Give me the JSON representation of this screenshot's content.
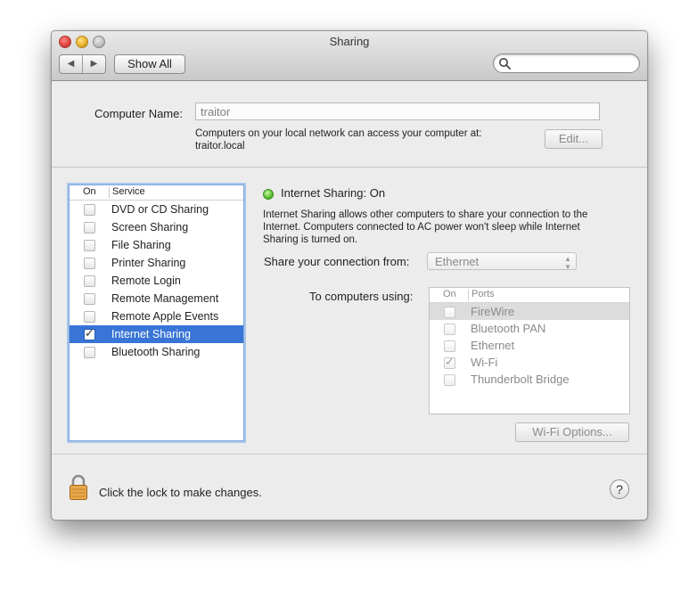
{
  "window": {
    "title": "Sharing",
    "nav_back_glyph": "◀",
    "nav_forward_glyph": "▶",
    "show_all_label": "Show All",
    "search": {
      "value": "",
      "placeholder": "",
      "icon": "search-icon"
    }
  },
  "computer_name": {
    "label": "Computer Name:",
    "value": "traitor",
    "description_line1": "Computers on your local network can access your computer at:",
    "description_line2": "traitor.local",
    "edit_label": "Edit..."
  },
  "services": {
    "header_on": "On",
    "header_service": "Service",
    "items": [
      {
        "label": "DVD or CD Sharing",
        "checked": false
      },
      {
        "label": "Screen Sharing",
        "checked": false
      },
      {
        "label": "File Sharing",
        "checked": false
      },
      {
        "label": "Printer Sharing",
        "checked": false
      },
      {
        "label": "Remote Login",
        "checked": false
      },
      {
        "label": "Remote Management",
        "checked": false
      },
      {
        "label": "Remote Apple Events",
        "checked": false
      },
      {
        "label": "Internet Sharing",
        "checked": true,
        "selected": true
      },
      {
        "label": "Bluetooth Sharing",
        "checked": false
      }
    ]
  },
  "detail": {
    "status_title": "Internet Sharing: On",
    "status_color": "#57c02a",
    "description_line1": "Internet Sharing allows other computers to share your connection to the",
    "description_line2": "Internet. Computers connected to AC power won't sleep while Internet",
    "description_line3": "Sharing is turned on.",
    "share_from_label": "Share your connection from:",
    "share_from_value": "Ethernet",
    "to_computers_label": "To computers using:",
    "ports_header_on": "On",
    "ports_header_ports": "Ports",
    "ports": [
      {
        "label": "FireWire",
        "checked": false,
        "highlighted": true
      },
      {
        "label": "Bluetooth PAN",
        "checked": false
      },
      {
        "label": "Ethernet",
        "checked": false
      },
      {
        "label": "Wi-Fi",
        "checked": true
      },
      {
        "label": "Thunderbolt Bridge",
        "checked": false
      }
    ],
    "wifi_options_label": "Wi-Fi Options..."
  },
  "footer": {
    "lock_text": "Click the lock to make changes.",
    "help_glyph": "?"
  },
  "colors": {
    "selection": "#3875d7",
    "window_bg": "#ececec"
  }
}
